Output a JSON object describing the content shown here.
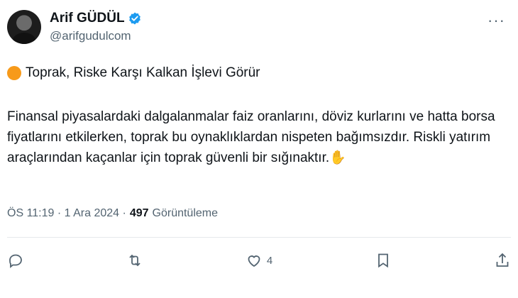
{
  "author": {
    "name": "Arif GÜDÜL",
    "handle": "@arifgudulcom",
    "verified_icon": "verified-badge-icon",
    "verified_color": "#1d9bf0"
  },
  "tweet": {
    "headline_icon": "orange-circle-icon",
    "headline_color": "#f79a1a",
    "headline": "Toprak, Riske Karşı Kalkan İşlevi Görür",
    "body": "Finansal piyasalardaki dalgalanmalar faiz oranlarını, döviz kurlarını ve hatta borsa fiyatlarını etkilerken, toprak bu oynaklıklardan nispeten bağımsızdır. Riskli yatırım araçlarından kaçanlar için toprak güvenli bir sığınaktır.✋"
  },
  "meta": {
    "timestamp": "ÖS 11:19 · 1 Ara 2024 ·",
    "views_count": "497",
    "views_label": "Görüntüleme"
  },
  "actions": {
    "reply_icon": "reply-icon",
    "retweet_icon": "retweet-icon",
    "like_icon": "heart-icon",
    "like_count": "4",
    "bookmark_icon": "bookmark-icon",
    "share_icon": "share-icon"
  },
  "menu": {
    "more_label": "···"
  }
}
